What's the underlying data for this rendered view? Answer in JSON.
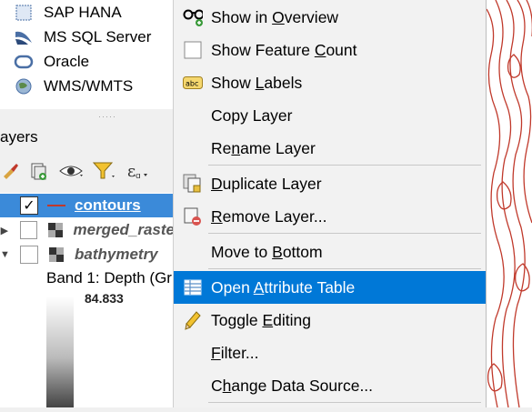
{
  "browser": {
    "items": [
      {
        "label": "SAP HANA",
        "icon": "sap-hana-icon"
      },
      {
        "label": "MS SQL Server",
        "icon": "mssql-icon"
      },
      {
        "label": "Oracle",
        "icon": "oracle-icon"
      },
      {
        "label": "WMS/WMTS",
        "icon": "wms-icon"
      }
    ]
  },
  "layers_panel": {
    "title": "ayers",
    "toolbar": [
      {
        "icon": "style-brush-icon"
      },
      {
        "icon": "add-group-icon"
      },
      {
        "icon": "visibility-eye-icon"
      },
      {
        "icon": "filter-icon"
      },
      {
        "icon": "expression-filter-icon"
      }
    ],
    "layers": [
      {
        "name": "contours",
        "checked": true,
        "selected": true
      },
      {
        "name": "merged_raste",
        "checked": false
      },
      {
        "name": "bathymetry",
        "checked": false
      }
    ],
    "band_label": "Band 1: Depth (Gr",
    "ramp_value": "84.833"
  },
  "context_menu": {
    "items": [
      {
        "pre": "Show in ",
        "u": "O",
        "post": "verview",
        "icon": "glasses-icon"
      },
      {
        "pre": "Show Feature ",
        "u": "C",
        "post": "ount",
        "icon": "checkbox-icon"
      },
      {
        "pre": "Show ",
        "u": "L",
        "post": "abels",
        "icon": "labels-abc-icon"
      },
      {
        "pre": "Copy Layer",
        "u": "",
        "post": "",
        "icon": ""
      },
      {
        "pre": "Re",
        "u": "n",
        "post": "ame Layer",
        "icon": ""
      },
      {
        "pre": "",
        "u": "D",
        "post": "uplicate Layer",
        "icon": "duplicate-layer-icon"
      },
      {
        "pre": "",
        "u": "R",
        "post": "emove Layer...",
        "icon": "remove-layer-icon"
      },
      {
        "pre": "Move to ",
        "u": "B",
        "post": "ottom",
        "icon": ""
      },
      {
        "pre": "Open ",
        "u": "A",
        "post": "ttribute Table",
        "icon": "attribute-table-icon"
      },
      {
        "pre": "Toggle ",
        "u": "E",
        "post": "diting",
        "icon": "pencil-icon"
      },
      {
        "pre": "",
        "u": "F",
        "post": "ilter...",
        "icon": ""
      },
      {
        "pre": "C",
        "u": "h",
        "post": "ange Data Source...",
        "icon": ""
      }
    ],
    "highlighted": "Open Attribute Table",
    "accent": "#0078d7"
  },
  "map": {
    "contour_color": "#c0392b"
  }
}
